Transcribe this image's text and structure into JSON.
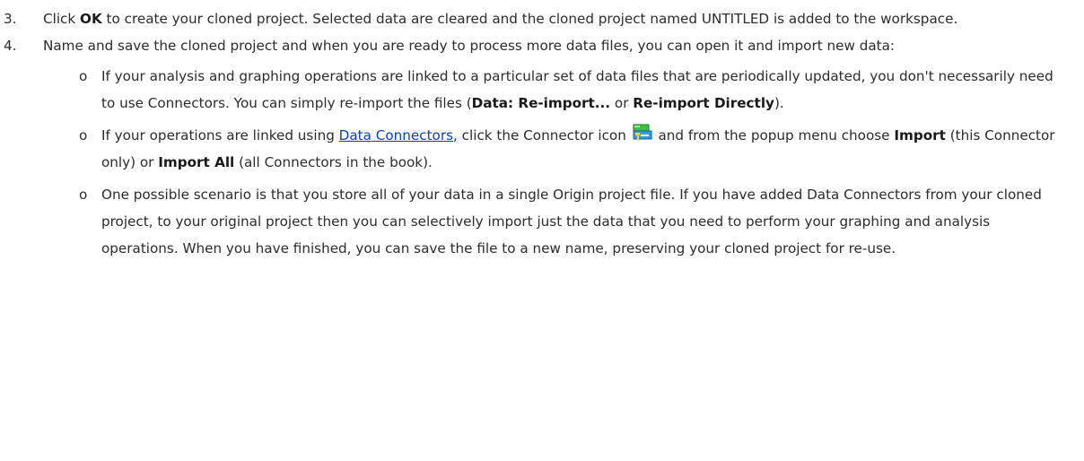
{
  "step3": {
    "number": "3.",
    "text_before": "Click ",
    "ok": "OK",
    "text_after": " to create your cloned project. Selected data are cleared and the cloned project named UNTITLED is added to the workspace."
  },
  "step4": {
    "number": "4.",
    "text": "Name and save the cloned project and when you are ready to process more data files, you can open it and import new data:",
    "bullets": [
      {
        "marker": "o",
        "text_before": "If your analysis and graphing operations are linked to a particular set of data files that are periodically updated, you don't necessarily need to use Connectors. You can simply re-import the files (",
        "bold1": "Data: Re-import...",
        "mid": " or ",
        "bold2": "Re-import Directly",
        "text_after": ")."
      },
      {
        "marker": "o",
        "text_before": "If your operations are linked using ",
        "link": "Data Connectors",
        "text_mid1": ", click the Connector icon ",
        "icon": "connector-icon",
        "text_mid2": " and from the popup menu choose ",
        "bold1": "Import",
        "text_mid3": " (this Connector only) or ",
        "bold2": "Import All",
        "text_after": " (all Connectors in the book)."
      },
      {
        "marker": "o",
        "text": "One possible scenario is that you store all of your data in a single Origin project file. If you have added Data Connectors from your cloned project, to your original project then you can selectively import just the data that you need to perform your graphing and analysis operations. When you have finished, you can save the file to a new name, preserving your cloned project for re-use."
      }
    ]
  }
}
